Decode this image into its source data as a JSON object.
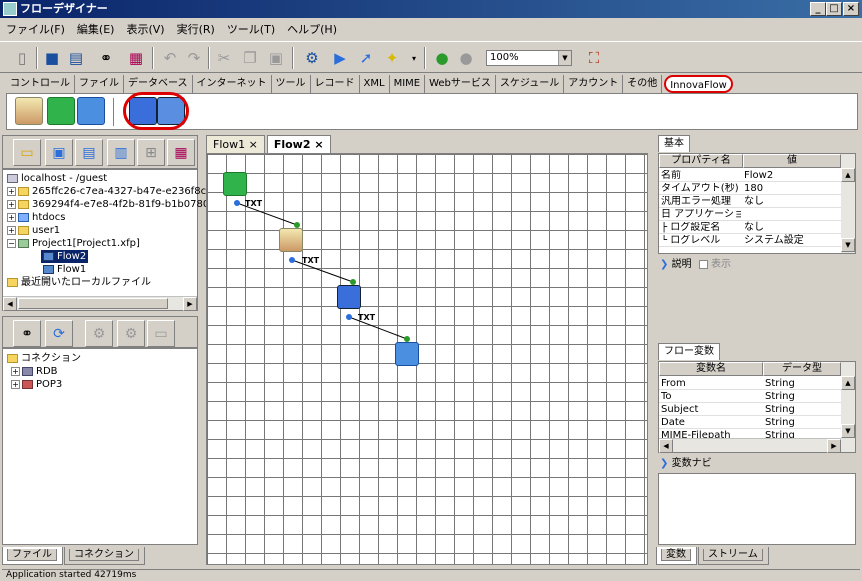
{
  "window": {
    "title": "フローデザイナー"
  },
  "menu": [
    "ファイル(F)",
    "編集(E)",
    "表示(V)",
    "実行(R)",
    "ツール(T)",
    "ヘルプ(H)"
  ],
  "toolbar": {
    "zoom": "100%"
  },
  "category_tabs": [
    "コントロール",
    "ファイル",
    "データベース",
    "インターネット",
    "ツール",
    "レコード",
    "XML",
    "MIME",
    "Webサービス",
    "スケジュール",
    "アカウント",
    "その他",
    "InnovaFlow"
  ],
  "tree1": {
    "items": [
      "localhost - /guest",
      "265ffc26-c7ea-4327-b47e-e236f8c1",
      "369294f4-e7e8-4f2b-81f9-b1b07802",
      "htdocs",
      "user1",
      "Project1[Project1.xfp]",
      "Flow2",
      "Flow1",
      "最近開いたローカルファイル"
    ]
  },
  "tree2": {
    "items": [
      "コネクション",
      "RDB",
      "POP3"
    ]
  },
  "left_tabs": [
    "ファイル",
    "コネクション"
  ],
  "editor_tabs": [
    "Flow1",
    "Flow2"
  ],
  "canvas": {
    "connector_label": "TXT"
  },
  "basic_tab": "基本",
  "props": {
    "headers": [
      "プロパティ名",
      "値"
    ],
    "rows": [
      {
        "k": "名前",
        "v": "Flow2"
      },
      {
        "k": "タイムアウト(秒)",
        "v": "180"
      },
      {
        "k": "汎用エラー処理",
        "v": "なし"
      },
      {
        "k": "日 アプリケーショ...",
        "v": ""
      },
      {
        "k": "├ ログ設定名",
        "v": "なし"
      },
      {
        "k": "└ ログレベル",
        "v": "システム設定"
      }
    ]
  },
  "desc": {
    "label": "説明",
    "checkbox": "表示"
  },
  "flowvar": {
    "tab": "フロー変数",
    "headers": [
      "変数名",
      "データ型"
    ],
    "rows": [
      {
        "k": "From",
        "v": "String"
      },
      {
        "k": "To",
        "v": "String"
      },
      {
        "k": "Subject",
        "v": "String"
      },
      {
        "k": "Date",
        "v": "String"
      },
      {
        "k": "MIME-Filepath",
        "v": "String"
      }
    ]
  },
  "navi": {
    "label": "変数ナビ"
  },
  "right_tabs": [
    "変数",
    "ストリーム"
  ],
  "status": "Application started 42719ms",
  "colors": {
    "selection_ring": "#dd0000",
    "title_bar": "#0a246a"
  }
}
